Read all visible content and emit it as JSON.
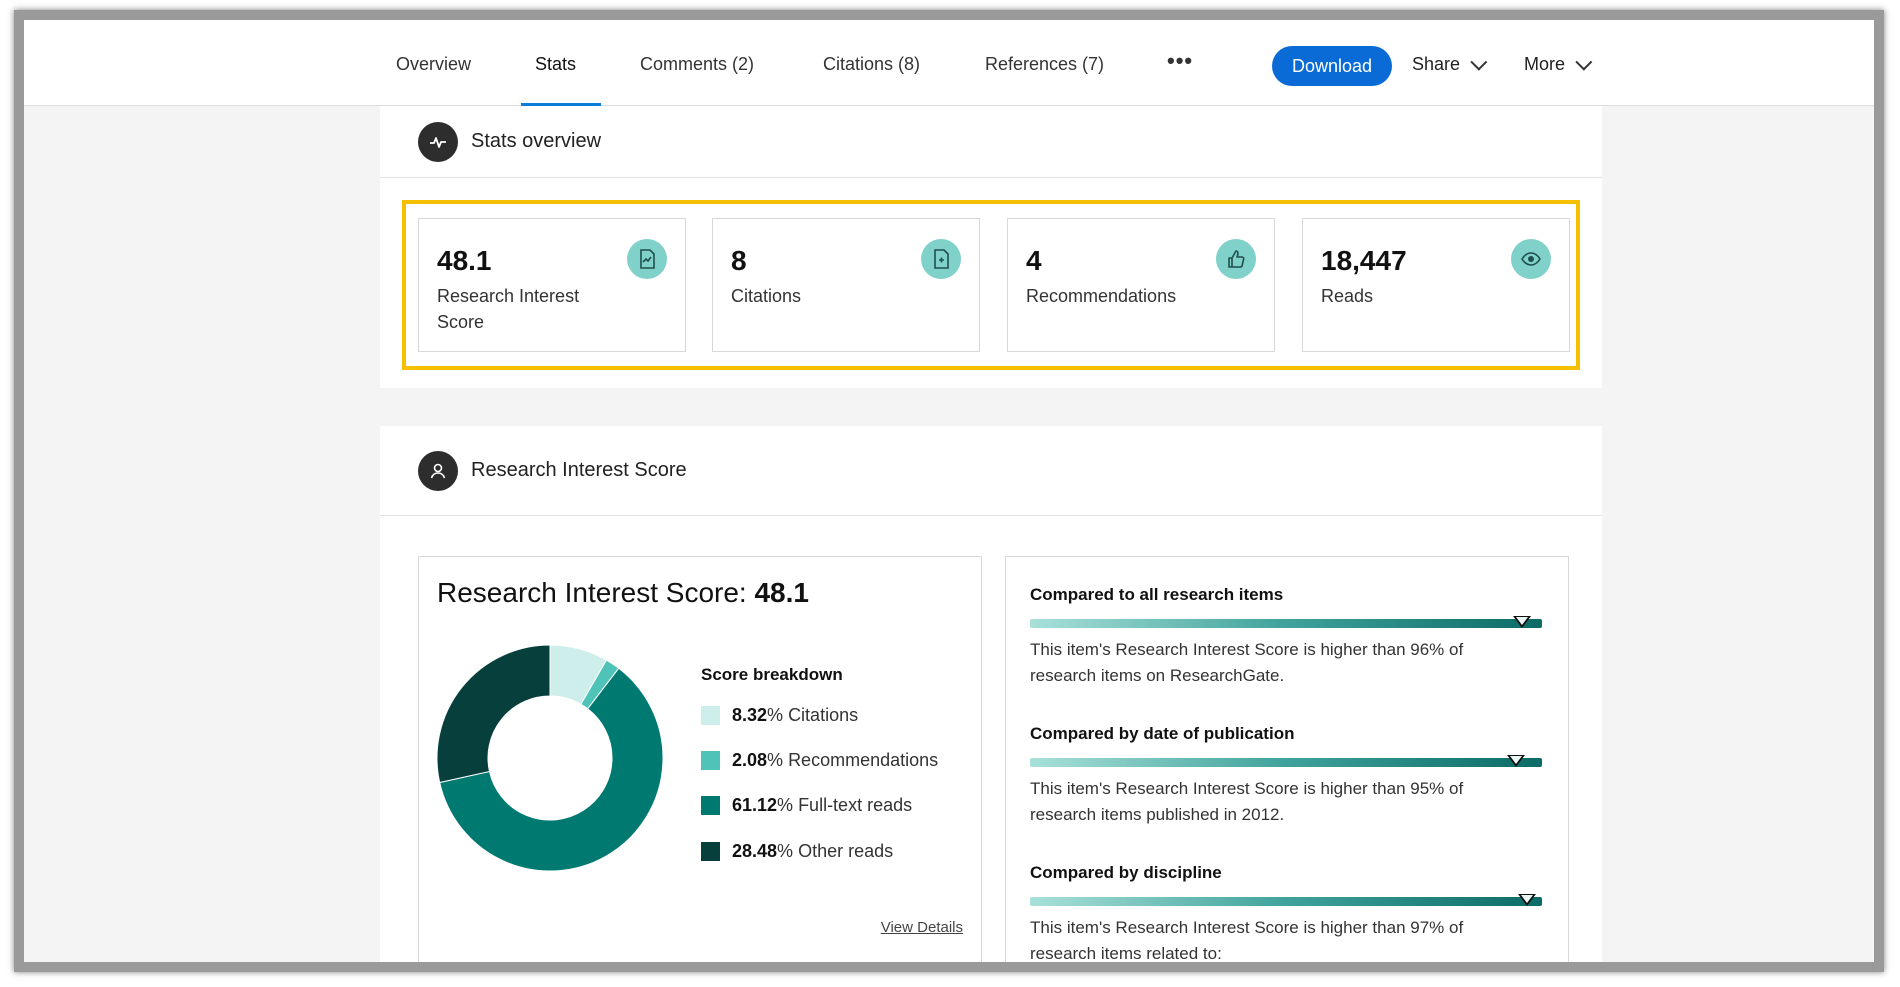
{
  "nav": {
    "tabs": [
      {
        "label": "Overview"
      },
      {
        "label": "Stats"
      },
      {
        "label": "Comments (2)"
      },
      {
        "label": "Citations (8)"
      },
      {
        "label": "References (7)"
      }
    ],
    "more_dots": "•••",
    "download_label": "Download",
    "share_label": "Share",
    "more_label": "More",
    "active_tab": "Stats"
  },
  "stats_overview": {
    "title": "Stats overview",
    "tiles": [
      {
        "value": "48.1",
        "label": "Research Interest Score",
        "icon": "research-score-icon"
      },
      {
        "value": "8",
        "label": "Citations",
        "icon": "citation-doc-icon"
      },
      {
        "value": "4",
        "label": "Recommendations",
        "icon": "thumbs-up-icon"
      },
      {
        "value": "18,447",
        "label": "Reads",
        "icon": "eye-icon"
      }
    ]
  },
  "ris": {
    "section_title": "Research Interest Score",
    "heading_prefix": "Research Interest Score: ",
    "heading_value": "48.1",
    "breakdown_title": "Score breakdown",
    "breakdown": [
      {
        "pct": "8.32",
        "label": "Citations",
        "color": "#cdeeeb"
      },
      {
        "pct": "2.08",
        "label": "Recommendations",
        "color": "#4fc3b8"
      },
      {
        "pct": "61.12",
        "label": "Full-text reads",
        "color": "#007a70"
      },
      {
        "pct": "28.48",
        "label": "Other reads",
        "color": "#063f3c"
      }
    ],
    "view_details": "View Details"
  },
  "comparisons": [
    {
      "title": "Compared to all research items",
      "text": "This item's Research Interest Score is higher than 96% of research items on ResearchGate.",
      "percentile": 96
    },
    {
      "title": "Compared by date of publication",
      "text": "This item's Research Interest Score is higher than 95% of research items published in 2012.",
      "percentile": 95
    },
    {
      "title": "Compared by discipline",
      "text": "This item's Research Interest Score is higher than 97% of research items related to:",
      "percentile": 97
    }
  ],
  "chart_data": {
    "type": "pie",
    "categories": [
      "Citations",
      "Recommendations",
      "Full-text reads",
      "Other reads"
    ],
    "values": [
      8.32,
      2.08,
      61.12,
      28.48
    ],
    "title": "Score breakdown"
  }
}
